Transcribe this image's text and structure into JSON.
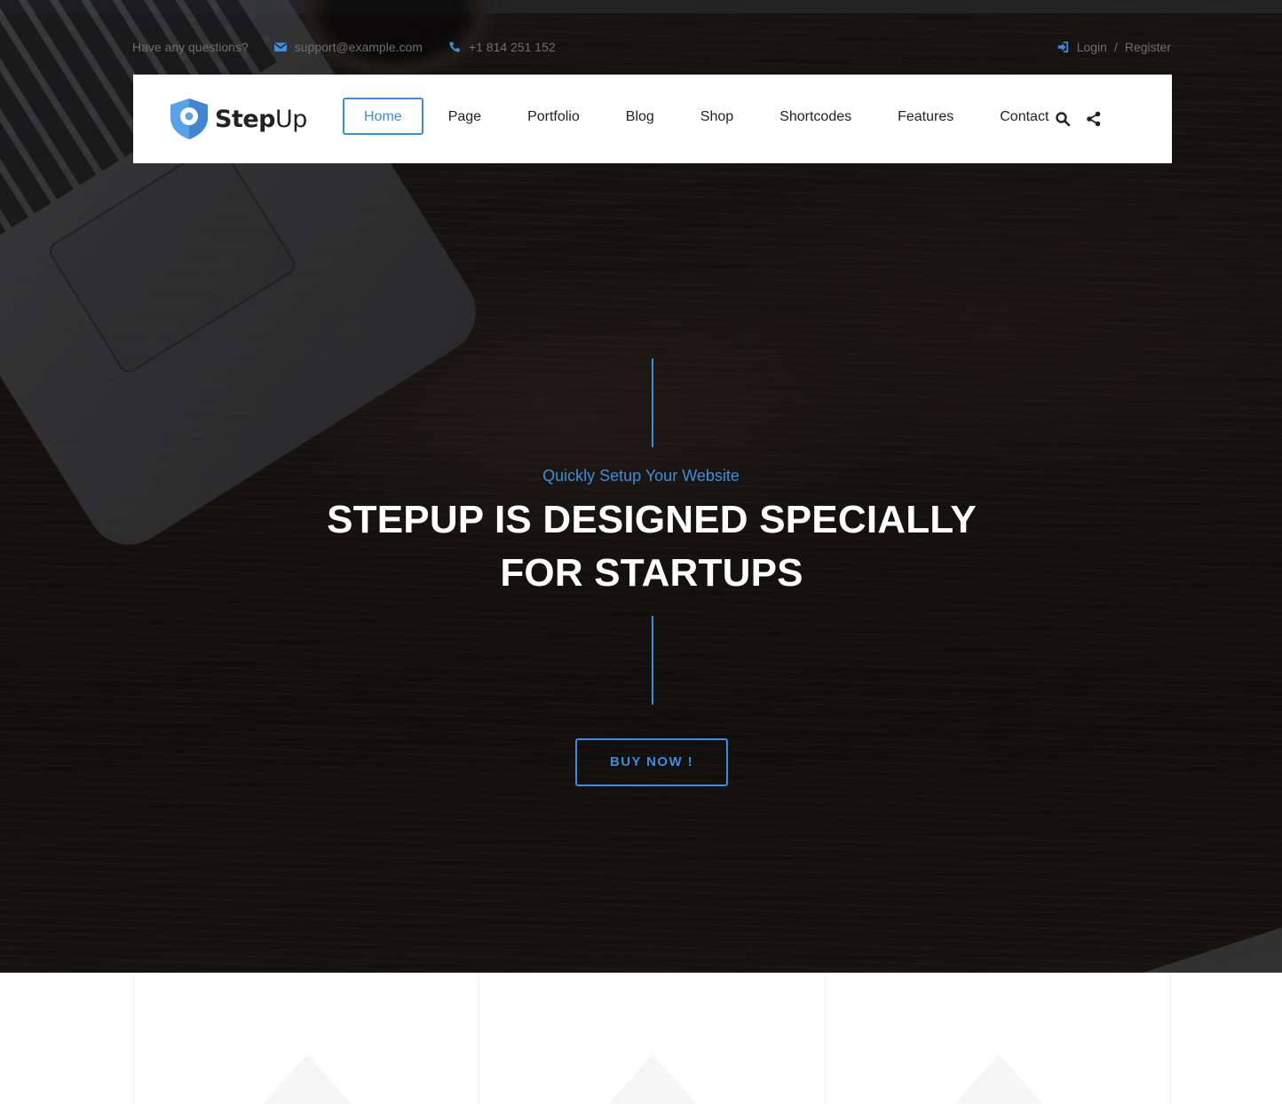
{
  "topbar": {
    "question": "Have any questions?",
    "email": "support@example.com",
    "phone": "+1 814 251 152",
    "login": "Login",
    "separator": "/",
    "register": "Register"
  },
  "logo": {
    "bold": "Step",
    "light": "Up"
  },
  "nav": {
    "items": [
      "Home",
      "Page",
      "Portfolio",
      "Blog",
      "Shop",
      "Shortcodes",
      "Features",
      "Contact"
    ],
    "active": "Home"
  },
  "hero": {
    "subtitle": "Quickly Setup Your Website",
    "headline_line1": "STEPUP IS DESIGNED SPECIALLY",
    "headline_line2": "FOR STARTUPS",
    "cta": "BUY NOW !"
  },
  "icons": {
    "email": "envelope-icon",
    "phone": "phone-icon",
    "login": "sign-in-icon",
    "search": "search-icon",
    "share": "share-icon",
    "logo": "shield-icon"
  },
  "colors": {
    "accent": "#3c8dde",
    "hero_dark": "#1b1714",
    "topbar_text": "#6f6f6f"
  }
}
